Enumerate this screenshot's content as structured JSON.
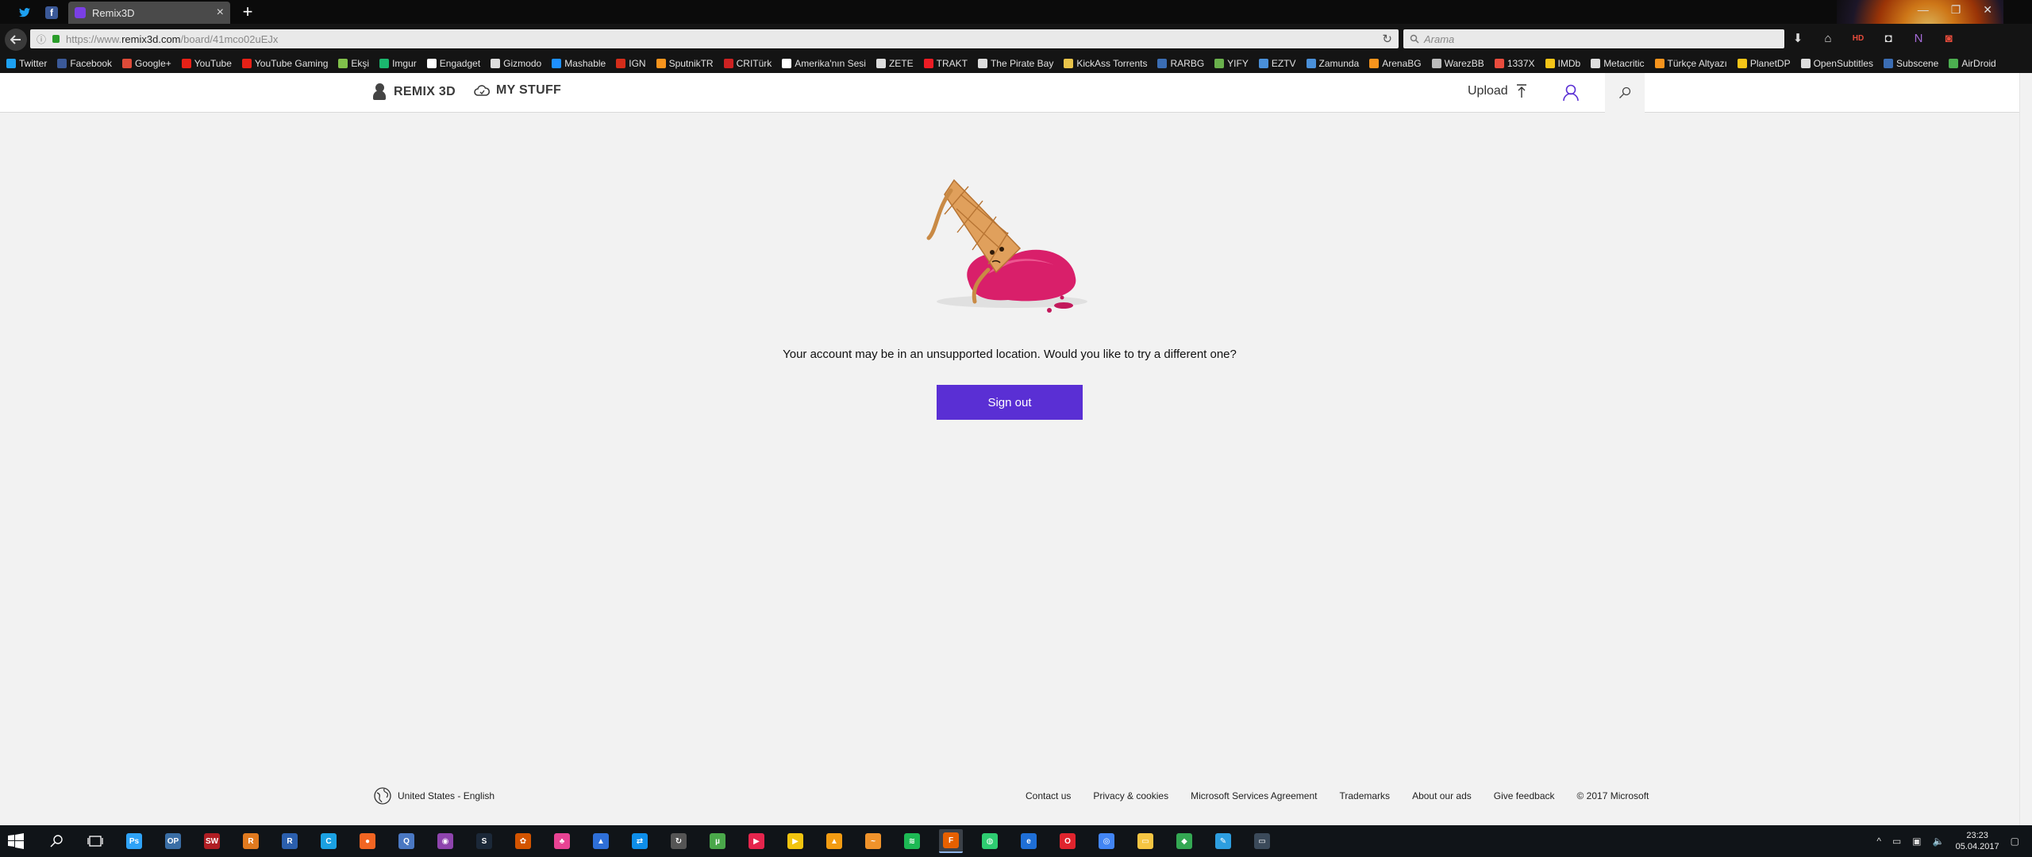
{
  "browser": {
    "tab_title": "Remix3D",
    "url_protocol": "https://www.",
    "url_host": "remix3d.com",
    "url_path": "/board/41mco02uEJx",
    "search_placeholder": "Arama",
    "pinned_tabs": [
      {
        "name": "twitter",
        "color": "#1da1f2"
      },
      {
        "name": "facebook",
        "color": "#3b5998"
      }
    ]
  },
  "bookmarks": [
    {
      "label": "Twitter",
      "color": "#1da1f2"
    },
    {
      "label": "Facebook",
      "color": "#3b5998"
    },
    {
      "label": "Google+",
      "color": "#dd4b39"
    },
    {
      "label": "YouTube",
      "color": "#e62117"
    },
    {
      "label": "YouTube Gaming",
      "color": "#e62117"
    },
    {
      "label": "Ekşi",
      "color": "#81c14b"
    },
    {
      "label": "Imgur",
      "color": "#1bb76e"
    },
    {
      "label": "Engadget",
      "color": "#ffffff"
    },
    {
      "label": "Gizmodo",
      "color": "#dddddd"
    },
    {
      "label": "Mashable",
      "color": "#1e90ff"
    },
    {
      "label": "IGN",
      "color": "#d42d1a"
    },
    {
      "label": "SputnikTR",
      "color": "#f7941d"
    },
    {
      "label": "CRITürk",
      "color": "#cc2222"
    },
    {
      "label": "Amerika'nın Sesi",
      "color": "#ffffff"
    },
    {
      "label": "ZETE",
      "color": "#dddddd"
    },
    {
      "label": "TRAKT",
      "color": "#ed1c24"
    },
    {
      "label": "The Pirate Bay",
      "color": "#dddddd"
    },
    {
      "label": "KickAss Torrents",
      "color": "#e8c34a"
    },
    {
      "label": "RARBG",
      "color": "#3b6db3"
    },
    {
      "label": "YIFY",
      "color": "#6ab04c"
    },
    {
      "label": "EZTV",
      "color": "#4a90d9"
    },
    {
      "label": "Zamunda",
      "color": "#4a90d9"
    },
    {
      "label": "ArenaBG",
      "color": "#f7941d"
    },
    {
      "label": "WarezBB",
      "color": "#bbbbbb"
    },
    {
      "label": "1337X",
      "color": "#e84c3d"
    },
    {
      "label": "IMDb",
      "color": "#f5c518"
    },
    {
      "label": "Metacritic",
      "color": "#dddddd"
    },
    {
      "label": "Türkçe Altyazı",
      "color": "#f7941d"
    },
    {
      "label": "PlanetDP",
      "color": "#f5c518"
    },
    {
      "label": "OpenSubtitles",
      "color": "#dddddd"
    },
    {
      "label": "Subscene",
      "color": "#3b6db3"
    },
    {
      "label": "AirDroid",
      "color": "#4caf50"
    }
  ],
  "header": {
    "brand": "REMIX 3D",
    "my_stuff": "MY STUFF",
    "upload": "Upload"
  },
  "main": {
    "message": "Your account may be in an unsupported location. Would you like to try a different one?",
    "sign_out": "Sign out"
  },
  "footer": {
    "locale": "United States - English",
    "links": [
      "Contact us",
      "Privacy & cookies",
      "Microsoft Services Agreement",
      "Trademarks",
      "About our ads",
      "Give feedback",
      "© 2017 Microsoft"
    ]
  },
  "taskbar": {
    "apps": [
      {
        "name": "photoshop",
        "color": "#2fa3f7",
        "glyph": "Ps"
      },
      {
        "name": "op-app",
        "color": "#3a6ea5",
        "glyph": "OP"
      },
      {
        "name": "sw-app",
        "color": "#b01e23",
        "glyph": "SW"
      },
      {
        "name": "r-app-orange",
        "color": "#e07a1f",
        "glyph": "R"
      },
      {
        "name": "r-app-blue",
        "color": "#2b5fad",
        "glyph": "R"
      },
      {
        "name": "c-app",
        "color": "#1ba1e2",
        "glyph": "C"
      },
      {
        "name": "orange-app",
        "color": "#f26522",
        "glyph": "●"
      },
      {
        "name": "q-app",
        "color": "#4a78c2",
        "glyph": "Q"
      },
      {
        "name": "purple-app",
        "color": "#8e44ad",
        "glyph": "◉"
      },
      {
        "name": "steam",
        "color": "#1b2838",
        "glyph": "S"
      },
      {
        "name": "cog-app",
        "color": "#d35400",
        "glyph": "✿"
      },
      {
        "name": "pink-app",
        "color": "#e84393",
        "glyph": "♣"
      },
      {
        "name": "shield-app",
        "color": "#2e6fd8",
        "glyph": "▲"
      },
      {
        "name": "teamviewer",
        "color": "#0e8ee9",
        "glyph": "⇄"
      },
      {
        "name": "sync-app",
        "color": "#555555",
        "glyph": "↻"
      },
      {
        "name": "utorrent",
        "color": "#4aa84a",
        "glyph": "µ"
      },
      {
        "name": "play-app",
        "color": "#e5254d",
        "glyph": "▶"
      },
      {
        "name": "yellow-app",
        "color": "#f1c40f",
        "glyph": "▶"
      },
      {
        "name": "warning-app",
        "color": "#f39c12",
        "glyph": "▲"
      },
      {
        "name": "fl-app",
        "color": "#f0932b",
        "glyph": "~"
      },
      {
        "name": "spotify",
        "color": "#1db954",
        "glyph": "≋"
      },
      {
        "name": "firefox",
        "color": "#e66000",
        "glyph": "F",
        "active": true
      },
      {
        "name": "globe-app",
        "color": "#2ecc71",
        "glyph": "◍"
      },
      {
        "name": "edge",
        "color": "#1f6fd6",
        "glyph": "e"
      },
      {
        "name": "opera",
        "color": "#e0242d",
        "glyph": "O"
      },
      {
        "name": "chrome",
        "color": "#4285f4",
        "glyph": "◎"
      },
      {
        "name": "file-explorer",
        "color": "#f5c542",
        "glyph": "▭"
      },
      {
        "name": "maps-app",
        "color": "#34a853",
        "glyph": "◆"
      },
      {
        "name": "paint-app",
        "color": "#2d9ee0",
        "glyph": "✎"
      },
      {
        "name": "window-app",
        "color": "#3b4a5a",
        "glyph": "▭"
      }
    ],
    "time": "23:23",
    "date": "05.04.2017"
  },
  "colors": {
    "accent": "#5a2fd4",
    "page_bg": "#f2f2f2"
  }
}
